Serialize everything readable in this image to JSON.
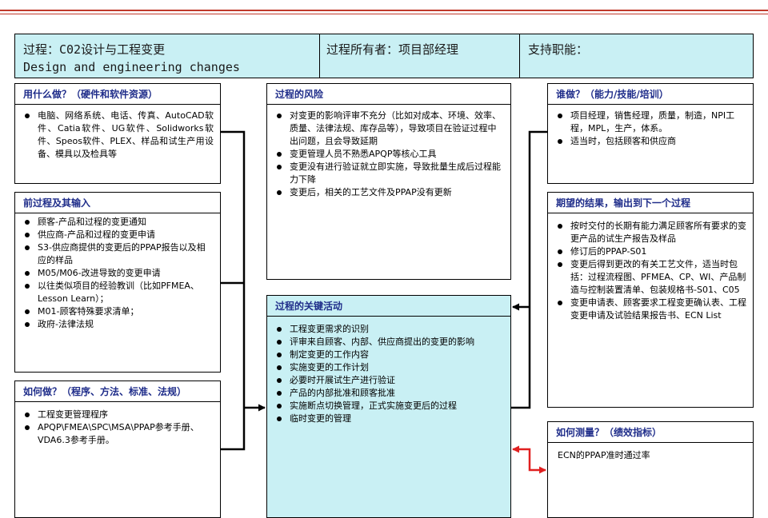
{
  "header": {
    "process_title_cn": "过程：C02设计与工程变更",
    "process_title_en": "Design and engineering changes",
    "owner": "过程所有者：项目部经理",
    "support": "支持职能："
  },
  "resources": {
    "title": "用什么做？（硬件和软件资源）",
    "items": [
      "电脑、网络系统、电话、传真、AutoCAD软件、Catia软件、UG软件、Solidworks软件、Speos软件、PLEX、样品和试生产用设备、模具以及检具等"
    ]
  },
  "risk": {
    "title": "过程的风险",
    "items": [
      "对变更的影响评审不充分（比如对成本、环境、效率、质量、法律法规、库存品等），导致项目在验证过程中出问题，且会导致延期",
      "变更管理人员不熟悉APQP等核心工具",
      "变更没有进行验证就立即实施，导致批量生成后过程能力下降",
      "变更后，相关的工艺文件及PPAP没有更新"
    ]
  },
  "who": {
    "title": "谁做？（能力/技能/培训）",
    "items": [
      "项目经理，销售经理，质量，制造，NPI工程，MPL，生产，体系。",
      "适当时，包括顾客和供应商"
    ]
  },
  "prior": {
    "title": "前过程及其输入",
    "items": [
      "顾客-产品和过程的变更通知",
      "供应商-产品和过程的变更申请",
      "S3-供应商提供的变更后的PPAP报告以及相应的样品",
      "M05/M06-改进导致的变更申请",
      "以往类似项目的经验教训（比如PFMEA、Lesson Learn）；",
      "M01-顾客特殊要求清单；",
      "政府-法律法规"
    ]
  },
  "results": {
    "title": "期望的结果，输出到下一个过程",
    "items": [
      "按时交付的长期有能力满足顾客所有要求的变更产品的试生产报告及样品",
      "修订后的PPAP-S01",
      "变更后得到更改的有关工艺文件，适当时包括：过程流程图、PFMEA、CP、WI、产品制造与控制装置清单、包装规格书-S01、C05",
      "变更申请表、顾客要求工程变更确认表、工程变更申请及试验结果报告书、ECN List"
    ]
  },
  "key": {
    "title": "过程的关键活动",
    "items": [
      "工程变更需求的识别",
      "评审来自顾客、内部、供应商提出的变更的影响",
      "制定变更的工作内容",
      "实施变更的工作计划",
      "必要时开展试生产进行验证",
      "产品的内部批准和顾客批准",
      "实施断点切换管理，正式实施变更后的过程",
      "临时变更的管理"
    ]
  },
  "how": {
    "title": "如何做？（程序、方法、标准、法规）",
    "items": [
      "工程变更管理程序",
      "APQP\\FMEA\\SPC\\MSA\\PPAP参考手册、VDA6.3参考手册。"
    ]
  },
  "measure": {
    "title": "如何测量？（绩效指标）",
    "text": "ECN的PPAP准时通过率"
  },
  "colors": {
    "header_bg": "#c9f0f4",
    "title_text": "#1f2d8a",
    "top_rule": "#c0392b",
    "measure_arrow": "#e02020"
  }
}
